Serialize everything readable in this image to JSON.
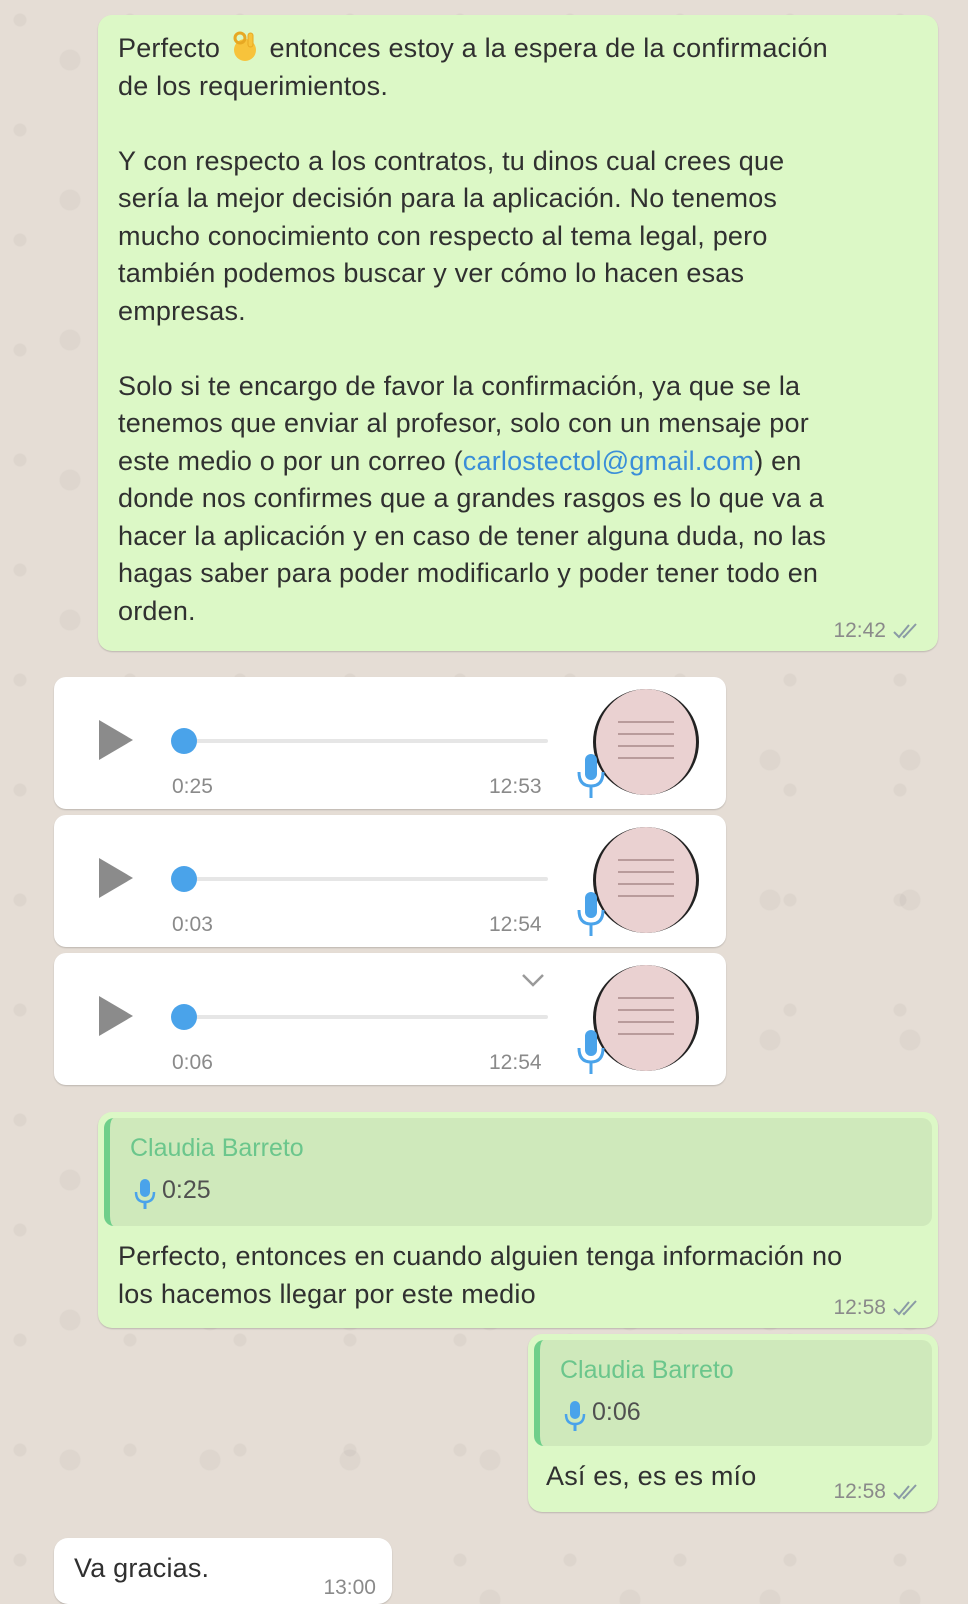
{
  "messages": {
    "m1": {
      "para1_before_emoji": "Perfecto ",
      "emoji": "ok-hand-emoji",
      "para1_after_emoji": " entonces estoy a la espera de la confirmación\nde los requerimientos.",
      "para2": "Y con respecto a los contratos, tu dinos cual crees que\nsería la mejor decisión para la aplicación. No tenemos\nmucho conocimiento con respecto al tema legal, pero\ntambién podemos buscar y ver cómo lo hacen esas\nempresas.",
      "para3_before_link": "Solo si te encargo de favor la confirmación, ya que se la\ntenemos que enviar al profesor, solo con un mensaje por\neste medio o por un correo (",
      "link": "carlostectol@gmail.com",
      "para3_after_link": ") en\ndonde nos confirmes que a grandes rasgos es lo que va a\nhacer la aplicación y en caso de tener alguna duda, no las\nhagas saber para poder modificarlo y poder tener todo en\norden.",
      "time": "12:42"
    },
    "audio1": {
      "duration": "0:25",
      "time": "12:53"
    },
    "audio2": {
      "duration": "0:03",
      "time": "12:54"
    },
    "audio3": {
      "duration": "0:06",
      "time": "12:54"
    },
    "m2": {
      "quote_name": "Claudia Barreto",
      "quote_duration": "0:25",
      "text": "Perfecto, entonces en cuando alguien tenga información no\nlos hacemos llegar por este medio",
      "time": "12:58"
    },
    "m3": {
      "quote_name": "Claudia Barreto",
      "quote_duration": "0:06",
      "text": "Así es, es es mío",
      "time": "12:58"
    },
    "m4": {
      "text": "Va gracias.",
      "time": "13:00"
    }
  },
  "colors": {
    "outgoing_bubble": "#dcf8c6",
    "incoming_bubble": "#ffffff",
    "accent_blue": "#4aa3ea",
    "quote_name_green": "#6bc68c"
  }
}
